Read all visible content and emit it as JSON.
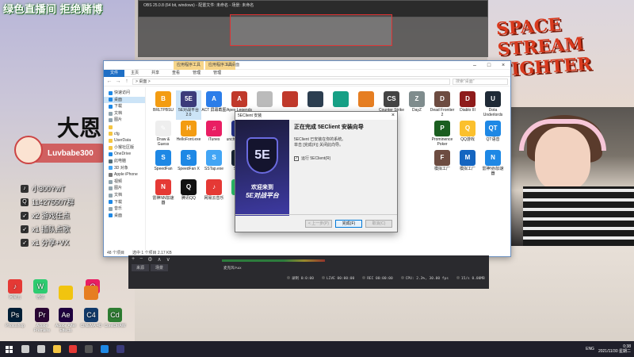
{
  "stream_overlay": {
    "banner": "绿色直播间 拒绝赌博",
    "big_text": "大恩",
    "game_logo_line1": "SPACE",
    "game_logo_line2": "STREAM",
    "game_logo_line3": "FIGHTER",
    "streamer_name": "Luvbabe300",
    "info": [
      {
        "icon": "tiktok-icon",
        "glyph": "♪",
        "text": "小300YwT"
      },
      {
        "icon": "qq-icon",
        "glyph": "Q",
        "text": "114275507群"
      },
      {
        "icon": "rocket-icon",
        "glyph": "➶",
        "text": "x2 游戏任点"
      },
      {
        "icon": "rocket-icon",
        "glyph": "➶",
        "text": "x1 插队点歌"
      },
      {
        "icon": "rocket-icon",
        "glyph": "➶",
        "text": "x1 分享+VX"
      }
    ]
  },
  "recorder": {
    "title": "OBS 25.0.8 (64 bit, windows) - 配置文件: 未命名 - 场景: 未命名"
  },
  "explorer": {
    "title_tools": [
      "应用程序工具",
      "应用程序工具"
    ],
    "title_path": "E:\\桌面",
    "ribbon": [
      "文件",
      "主页",
      "共享",
      "查看",
      "管理",
      "管理"
    ],
    "address": "> 桌面 >",
    "search_placeholder": "搜索\"桌面\"",
    "nav": [
      {
        "label": "快速访问",
        "color": "#1e88e5"
      },
      {
        "label": "桌面",
        "color": "#1e88e5"
      },
      {
        "label": "下载",
        "color": "#1e88e5"
      },
      {
        "label": "文档",
        "color": "#90a4ae"
      },
      {
        "label": "图片",
        "color": "#90a4ae"
      },
      {
        "label": "",
        "color": "#f4c542"
      },
      {
        "label": "cfg",
        "color": "#f4c542"
      },
      {
        "label": "UserData",
        "color": "#f4c542"
      },
      {
        "label": "小猴社区版",
        "color": "#f4c542"
      },
      {
        "label": "OneDrive",
        "color": "#1e88e5"
      },
      {
        "label": "此电脑",
        "color": "#546e7a"
      },
      {
        "label": "3D 对象",
        "color": "#42a5f5"
      },
      {
        "label": "Apple iPhone",
        "color": "#777777"
      },
      {
        "label": "视频",
        "color": "#90a4ae"
      },
      {
        "label": "图片",
        "color": "#90a4ae"
      },
      {
        "label": "文档",
        "color": "#90a4ae"
      },
      {
        "label": "下载",
        "color": "#1e88e5"
      },
      {
        "label": "音乐",
        "color": "#90a4ae"
      },
      {
        "label": "桌面",
        "color": "#1e88e5"
      }
    ],
    "files": [
      {
        "name": "BRLTPBSU",
        "color": "#f39c12",
        "glyph": "B"
      },
      {
        "name": "5E对战平台2.0",
        "color": "#3b3b7a",
        "glyph": "5E",
        "selected": true
      },
      {
        "name": "ACT 屏幕截图",
        "color": "#2b7de9",
        "glyph": "A"
      },
      {
        "name": "Apex Legends",
        "color": "#c0392b",
        "glyph": "A"
      },
      {
        "name": "",
        "color": "#bbbbbb",
        "glyph": ""
      },
      {
        "name": "",
        "color": "#c0392b",
        "glyph": ""
      },
      {
        "name": "",
        "color": "#2c3e50",
        "glyph": ""
      },
      {
        "name": "",
        "color": "#16a085",
        "glyph": ""
      },
      {
        "name": "",
        "color": "#e67e22",
        "glyph": ""
      },
      {
        "name": "Counter Strike",
        "color": "#444444",
        "glyph": "CS"
      },
      {
        "name": "DayZ",
        "color": "#7f8c8d",
        "glyph": "Z"
      },
      {
        "name": "Dead Frontier 2",
        "color": "#6d4c41",
        "glyph": "D"
      },
      {
        "name": "Diablo III",
        "color": "#8e1b1b",
        "glyph": "D"
      },
      {
        "name": "Dota Underlords",
        "color": "#1f2a36",
        "glyph": "U"
      },
      {
        "name": "Draw & Guess",
        "color": "#eeeeee",
        "glyph": "✎"
      },
      {
        "name": "HelloFont.exe",
        "color": "#f39c12",
        "glyph": "H"
      },
      {
        "name": "iTunes",
        "color": "#e91e63",
        "glyph": "♫"
      },
      {
        "name": "LauncherGame.exe",
        "color": "#283593",
        "glyph": "L"
      },
      {
        "name": "",
        "color": "#ffffff",
        "glyph": ""
      },
      {
        "name": "",
        "color": "#ffffff",
        "glyph": ""
      },
      {
        "name": "",
        "color": "#ffffff",
        "glyph": ""
      },
      {
        "name": "",
        "color": "#ffffff",
        "glyph": ""
      },
      {
        "name": "",
        "color": "#ffffff",
        "glyph": ""
      },
      {
        "name": "",
        "color": "#ffffff",
        "glyph": ""
      },
      {
        "name": "",
        "color": "#ffffff",
        "glyph": ""
      },
      {
        "name": "Prominence Poker",
        "color": "#1b5e20",
        "glyph": "P"
      },
      {
        "name": "QQ游戏",
        "color": "#fbc02d",
        "glyph": "Q"
      },
      {
        "name": "QT语音",
        "color": "#1e88e5",
        "glyph": "QT"
      },
      {
        "name": "SpeedFan",
        "color": "#1e88e5",
        "glyph": "S"
      },
      {
        "name": "SpeedFan X",
        "color": "#1e88e5",
        "glyph": "S"
      },
      {
        "name": "SSTap.exe",
        "color": "#42a5f5",
        "glyph": "S"
      },
      {
        "name": "Steam",
        "color": "#1b2838",
        "glyph": "S"
      },
      {
        "name": "",
        "color": "#ffffff",
        "glyph": ""
      },
      {
        "name": "",
        "color": "#ffffff",
        "glyph": ""
      },
      {
        "name": "",
        "color": "#ffffff",
        "glyph": ""
      },
      {
        "name": "",
        "color": "#ffffff",
        "glyph": ""
      },
      {
        "name": "",
        "color": "#ffffff",
        "glyph": ""
      },
      {
        "name": "",
        "color": "#ffffff",
        "glyph": ""
      },
      {
        "name": "",
        "color": "#ffffff",
        "glyph": ""
      },
      {
        "name": "模拟工厂",
        "color": "#6d4c41",
        "glyph": "F"
      },
      {
        "name": "模拟工厂",
        "color": "#1565c0",
        "glyph": "M"
      },
      {
        "name": "雷神NN加速器",
        "color": "#1e88e5",
        "glyph": "N"
      },
      {
        "name": "雷神NN加速器",
        "color": "#e53935",
        "glyph": "N"
      },
      {
        "name": "腾讯QQ",
        "color": "#111111",
        "glyph": "Q"
      },
      {
        "name": "网易云音乐",
        "color": "#e53935",
        "glyph": "♪"
      },
      {
        "name": "微信",
        "color": "#2ecc71",
        "glyph": "W"
      }
    ],
    "status_count": "48 个项目",
    "status_selected": "选中 1 个项目  2.17 KB"
  },
  "dialog": {
    "title": "5EClient 安装",
    "close": "×",
    "left_logo": "5E",
    "slogan1": "欢迎来到",
    "slogan2": "5E对战平台",
    "heading": "正在完成 5EClient 安装向导",
    "text1": "5EClient 已安装在你的系统。",
    "text2": "单击 [完成(F)] 关闭此向导。",
    "checkbox_label": "运行 5EClient(R)",
    "checkbox_checked": true,
    "btn_back": "< 上一步(P)",
    "btn_finish": "完成(F)",
    "btn_cancel": "取消(C)"
  },
  "obs": {
    "toolbar": [
      "+",
      "−",
      "⚙",
      "∧",
      "∨"
    ],
    "tabs": [
      "来源",
      "场景"
    ],
    "device": "麦克风/Aux",
    "stats": [
      "录制 0:0:00",
      "LIVE 00:00:00",
      "REC 00:00:00",
      "CPU: 2.3%, 30.00 fps",
      "15/s 0.00MB"
    ]
  },
  "desktop_icons": [
    {
      "name": "网易云",
      "color": "#e53935",
      "glyph": "♪"
    },
    {
      "name": "微信",
      "color": "#2ecc71",
      "glyph": "W"
    },
    {
      "name": "QQ",
      "color": "#e91e63",
      "glyph": "Q"
    },
    {
      "name": "",
      "color": "#f1c40f",
      "glyph": ""
    },
    {
      "name": "",
      "color": "#e67e22",
      "glyph": ""
    },
    {
      "name": "Photoshop",
      "color": "#001e36",
      "glyph": "Ps"
    },
    {
      "name": "Adobe Premiere",
      "color": "#2a0634",
      "glyph": "Pr"
    },
    {
      "name": "Adobe After Effects",
      "color": "#1f0040",
      "glyph": "Ae"
    },
    {
      "name": "CINEMA 4D",
      "color": "#123a6a",
      "glyph": "C4"
    },
    {
      "name": "CorelDRAW",
      "color": "#2e7d32",
      "glyph": "Cd"
    }
  ],
  "taskbar": {
    "ime": "ENG",
    "time": "0:38",
    "date": "2021/11/30 星期二",
    "apps": [
      {
        "icon": "search-icon",
        "color": "#cccccc"
      },
      {
        "icon": "task-view-icon",
        "color": "#cccccc"
      },
      {
        "icon": "explorer-icon",
        "color": "#f4c542"
      },
      {
        "icon": "netease-icon",
        "color": "#e53935"
      },
      {
        "icon": "obs-icon",
        "color": "#555555"
      },
      {
        "icon": "qq-icon",
        "color": "#1e88e5"
      },
      {
        "icon": "installer-icon",
        "color": "#3b3b7a"
      }
    ]
  }
}
